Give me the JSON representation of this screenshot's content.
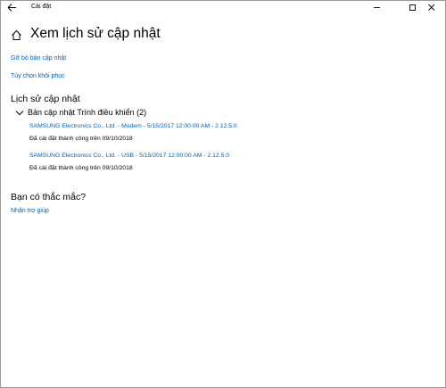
{
  "window": {
    "title": "Cài đặt"
  },
  "header": {
    "title": "Xem lịch sử cập nhật"
  },
  "links": {
    "uninstall": "Gỡ bỏ bản cập nhật",
    "recovery": "Tùy chọn khôi phục"
  },
  "history": {
    "heading": "Lịch sử cập nhật",
    "group_label": "Bản cập nhật Trình điều khiển (2)",
    "items": [
      {
        "title": "SAMSUNG Electronics Co., Ltd.  - Modem - 5/15/2017 12:00:00 AM - 2.12.5.0",
        "status": "Đã cài đặt thành công trên 09/10/2018"
      },
      {
        "title": "SAMSUNG Electronics Co., Ltd.  - USB - 5/15/2017 12:00:00 AM - 2.12.5.0",
        "status": "Đã cài đặt thành công trên 09/10/2018"
      }
    ]
  },
  "help": {
    "heading": "Bạn có thắc mắc?",
    "link": "Nhận trợ giúp"
  },
  "colors": {
    "link": "#0063b1",
    "text": "#000000",
    "background": "#ffffff"
  }
}
